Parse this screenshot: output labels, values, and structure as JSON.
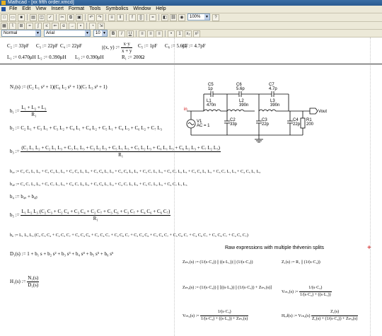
{
  "window": {
    "title": "Mathcad - [xx fifth order.xmcd]"
  },
  "menu": [
    "File",
    "Edit",
    "View",
    "Insert",
    "Format",
    "Tools",
    "Symbolics",
    "Window",
    "Help"
  ],
  "toolbar": {
    "zoom": "100%",
    "style": "Normal",
    "font": "Arial",
    "font_size": "10"
  },
  "components": {
    "c_row": [
      "C₂ := 33pF",
      "C₃ := 22pF",
      "C₄ := 22pF",
      "C₅ := 1pF",
      "C₆ := 5.6pF",
      "C₇ := 4.7pF"
    ],
    "l_row": [
      "L₁ := 0.470μH",
      "L₂ := 0.390μH",
      "L₃ := 0.390μH",
      "R₁ := 200Ω"
    ],
    "par_func": "(x, y) :=",
    "par_num": "x·y",
    "par_den": "x + y"
  },
  "equations": {
    "n1": "N₁(s) := (C₂ L₁ s² + 1)(C₆ L₂ s² + 1)(C₇ L₃ s² + 1)",
    "b1_lhs": "b₁ :=",
    "b1_num": "L₁ + L₂ + L₃",
    "b1_den": "R₁",
    "b2": "b₂ := C₂ L₁ + C₃ L₁ + C₃ L₂ + C₄ L₁ + C₄ L₂ + C₅ L₁ + C₄ L₃ + C₆ L₂ + C₇ L₃",
    "b3_lhs": "b₃ :=",
    "b3_num": "(C₂ L₁ L₂ + C₂ L₁ L₃ + C₃ L₁ L₃ + C₃ L₂ L₃ + C₅ L₁ L₃ + C₅ L₂ L₃ + C₆ L₁ L₃ + C₆ L₂ L₃ + C₇ L₂ L₃)",
    "b3_den": "R₁",
    "b4a": "b₄ₐ := C₂ C₃ L₁ L₂ + C₂ C₄ L₁ L₂ + C₂ C₄ L₁ L₃ + C₃ C₆ L₁ L₂ + C₃ C₆ L₂ L₃ + C₃ C₇ L₁ L₃ + C₃ C₇ L₂ L₃ + C₃ C₄ L₁ L₃ + C₃ C₇ L₁ L₃ + C₄ C₅ L₁ L₃",
    "b4b": "b₄ᵦ := C₄ C₇ L₂ L₃ + C₅ C₇ L₁ L₃ + C₆ C₇ L₂ L₃ + C₅ C₆ L₁ L₂ + C₄ C₇ L₁ L₃ + C₅ C₇ L₂ L₃ + C₆ C₇ L₁ L₃",
    "b4": "b₄ := b₄ₐ + b₄ᵦ",
    "b5_lhs": "b₅ :=",
    "b5_num": "L₁ L₂ L₃ (C₂ C₃ + C₂ C₄ + C₃ C₄ + C₂ C₇ + C₃ C₆ + C₃ C₇ + C₄ C₆ + C₆ C₇)",
    "b5_den": "R₁",
    "b6": "b₆ := L₁ L₂ L₃ (C₂ C₃ C₄ + C₂ C₃ C₇ + C₂ C₄ C₆ + C₂ C₄ C₇ + C₂ C₆ C₇ + C₃ C₄ C₆ + C₃ C₄ C₇ + C₃ C₆ C₇ + C₄ C₆ C₇ + C₅ C₆ C₇ + C₄ C₅ C₇)",
    "d1": "D₁(s) := 1 + b₁ s + b₂ s² + b₃ s³ + b₄ s⁴ + b₅ s⁵ + b₆ s⁶",
    "h1_lhs": "H₁(s) :=",
    "h1_num": "N₁(s)",
    "h1_den": "D₁(s)"
  },
  "circuit": {
    "c5": "C5",
    "c5v": "1p",
    "c6": "C6",
    "c6v": "5.6p",
    "c7": "C7",
    "c7v": "4.7p",
    "l1": "L1",
    "l1v": "470n",
    "l2": "L2",
    "l2v": "390n",
    "l3": "L3",
    "l3v": "390n",
    "c2": "C2",
    "c2v": "33p",
    "c3": "C3",
    "c3v": "22p",
    "c4": "C4",
    "c4v": "22p",
    "r1": "R1",
    "r1v": "200",
    "v1": "V1",
    "v1v": "AC = 1",
    "vout": "Vout"
  },
  "thevenin": {
    "heading": "Raw expressions with multiple thévenin splits",
    "zth1_lhs": "Zₜₕ₁(s) :=",
    "z1_lhs": "Z₁(s) := R₁ ||",
    "zth2_lhs": "Zₜₕ₂(s) :=",
    "vth1_lhs": "Vₜₕ₁(s) :=",
    "vth2_lhs": "Vₜₕ₂(s) :=",
    "href_lhs": "Hᵣₑf(s) := Vₜₕ₂(s)",
    "one_over_sc2": "1/(s·C₂)",
    "one_over_sc3": "1/(s·C₃)",
    "one_over_sc4": "1/(s·C₄)",
    "one_over_sc5": "1/(s·C₅)",
    "sl1": "(s·L₁)",
    "sl2": "(s·L₂)",
    "zth1": "Zₜₕ₁(s)",
    "zth2": "Zₜₕ₂(s)",
    "z1s": "Z₁(s)"
  }
}
